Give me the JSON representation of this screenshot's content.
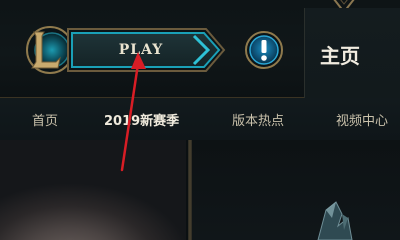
{
  "header": {
    "play_label": "PLAY",
    "home_label": "主页"
  },
  "nav": {
    "items": [
      {
        "label": "首页"
      },
      {
        "label": "2019新赛季"
      },
      {
        "label": "版本热点"
      },
      {
        "label": "视频中心"
      }
    ]
  },
  "icons": {
    "logo": "league-of-legends-logo",
    "alert": "alert-icon",
    "annotation": "red-arrow-annotation"
  },
  "colors": {
    "gold": "#c8aa6e",
    "teal": "#0a8fa6",
    "arrow": "#d81d25"
  }
}
